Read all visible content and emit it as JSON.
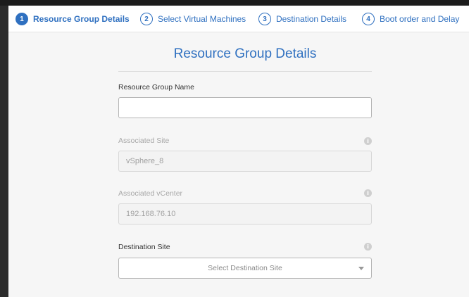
{
  "stepper": {
    "steps": [
      {
        "num": "1",
        "label": "Resource Group Details"
      },
      {
        "num": "2",
        "label": "Select Virtual Machines"
      },
      {
        "num": "3",
        "label": "Destination Details"
      },
      {
        "num": "4",
        "label": "Boot order and Delay"
      }
    ],
    "active_index": 0
  },
  "form": {
    "title": "Resource Group Details",
    "resource_group_name": {
      "label": "Resource Group Name",
      "value": "",
      "placeholder": ""
    },
    "associated_site": {
      "label": "Associated Site",
      "value": "vSphere_8"
    },
    "associated_vcenter": {
      "label": "Associated vCenter",
      "value": "192.168.76.10"
    },
    "destination_site": {
      "label": "Destination Site",
      "placeholder": "Select Destination Site"
    },
    "info_glyph": "i"
  },
  "colors": {
    "accent": "#2f70c0",
    "panel_bg": "#f6f6f6",
    "frame_bg": "#2a2a2a"
  }
}
